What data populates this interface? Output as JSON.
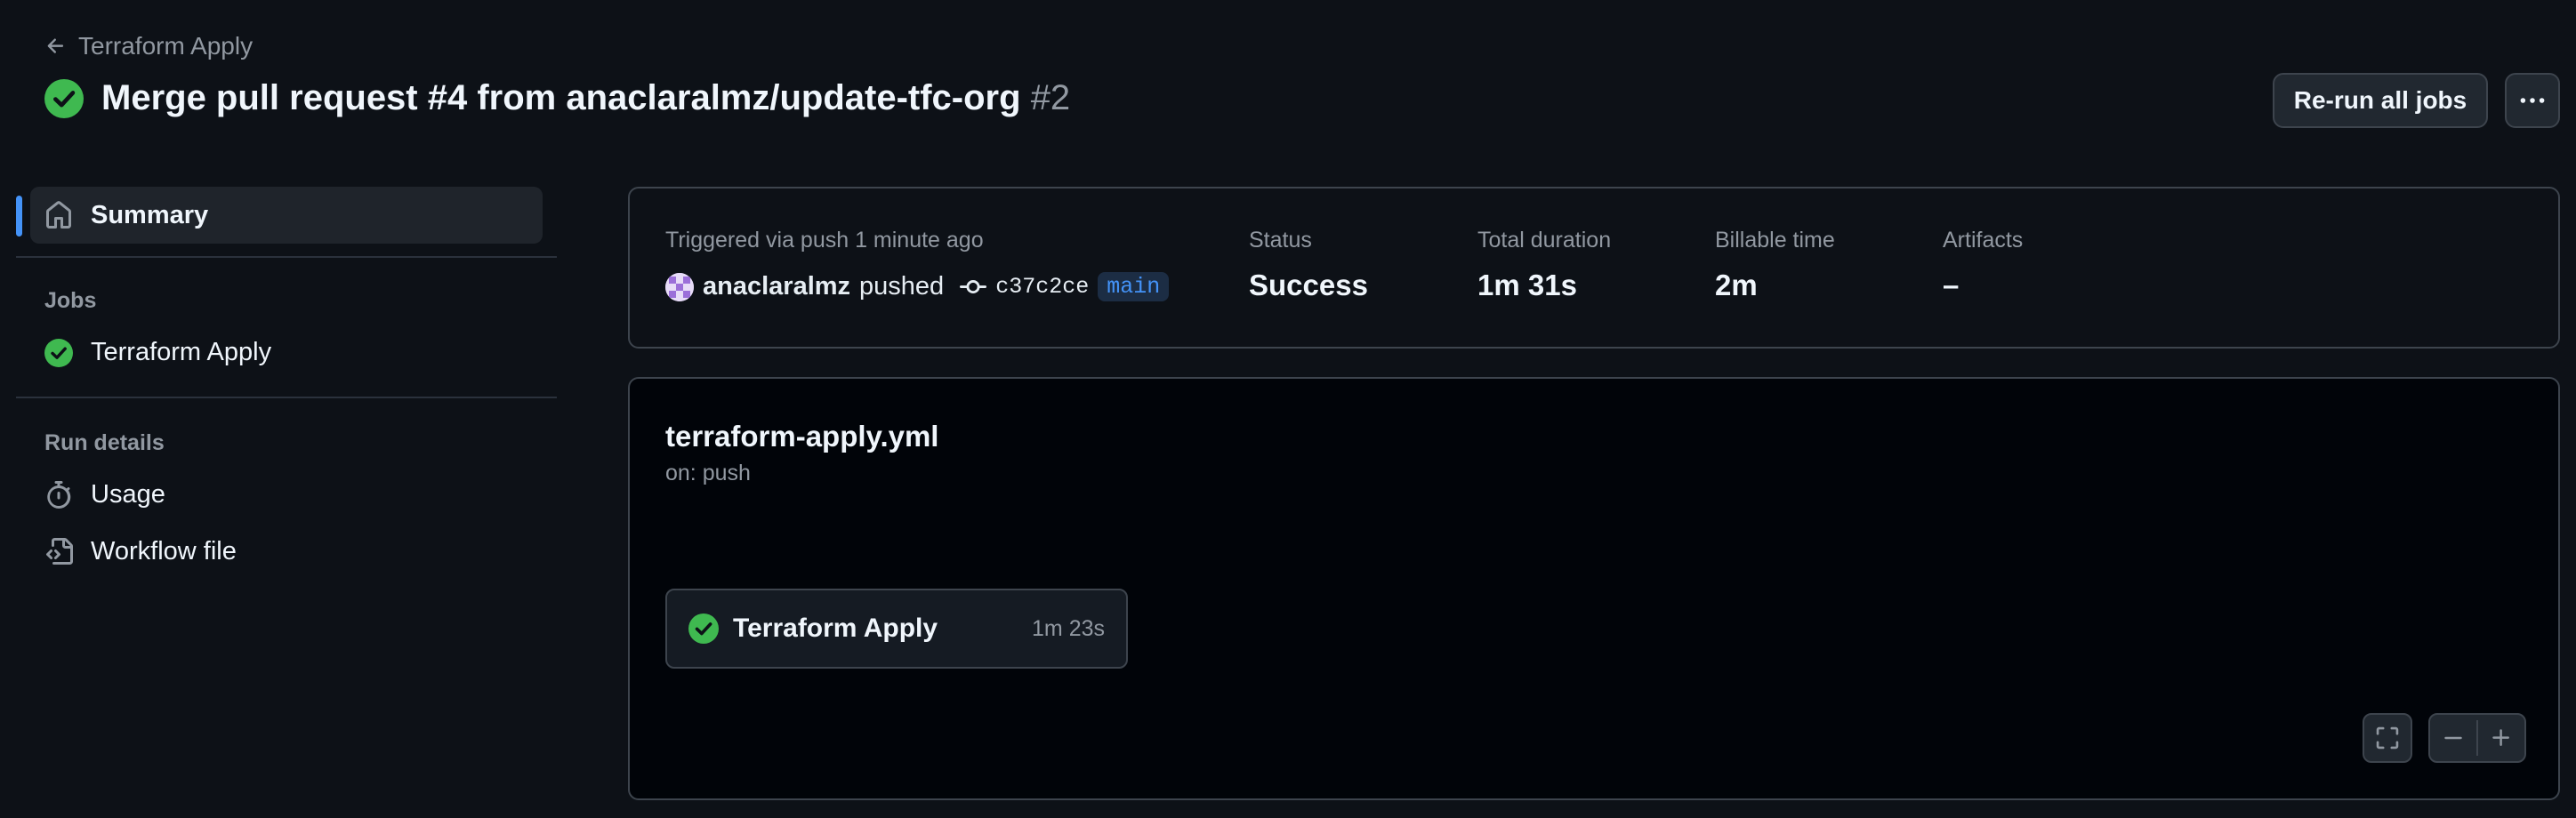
{
  "header": {
    "back_label": "Terraform Apply",
    "title": "Merge pull request #4 from anaclaralmz/update-tfc-org",
    "run_number": "#2",
    "rerun_label": "Re-run all jobs",
    "more_label": "···"
  },
  "sidebar": {
    "summary_label": "Summary",
    "jobs_heading": "Jobs",
    "jobs": [
      {
        "label": "Terraform Apply",
        "status": "success"
      }
    ],
    "run_details_heading": "Run details",
    "usage_label": "Usage",
    "workflow_file_label": "Workflow file"
  },
  "summary": {
    "trigger_text": "Triggered via push 1 minute ago",
    "actor": "anaclaralmz",
    "action": "pushed",
    "commit": "c37c2ce",
    "branch": "main",
    "status_label": "Status",
    "status_value": "Success",
    "duration_label": "Total duration",
    "duration_value": "1m 31s",
    "billable_label": "Billable time",
    "billable_value": "2m",
    "artifacts_label": "Artifacts",
    "artifacts_value": "–"
  },
  "workflow": {
    "file_name": "terraform-apply.yml",
    "trigger": "on: push",
    "job_name": "Terraform Apply",
    "job_duration": "1m 23s"
  },
  "colors": {
    "background": "#0d1117",
    "success": "#3fb950",
    "accent": "#4493f8"
  },
  "icons": {
    "back": "arrow-left-icon",
    "status": "check-circle-fill-icon",
    "summary": "home-icon",
    "usage": "stopwatch-icon",
    "workflow_file": "file-code-icon",
    "commit": "git-commit-icon",
    "fullscreen": "screen-full-icon",
    "zoom_out": "minus-icon",
    "zoom_in": "plus-icon"
  }
}
